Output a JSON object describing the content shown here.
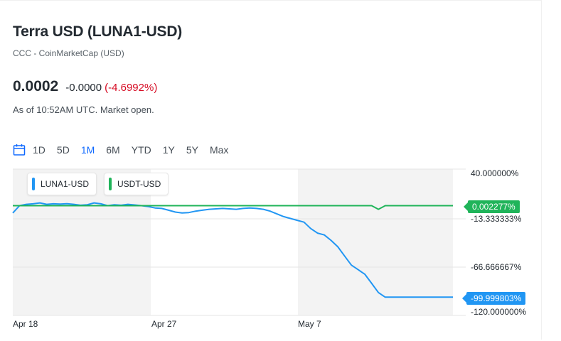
{
  "quote": {
    "title": "Terra USD (LUNA1-USD)",
    "subtitle": "CCC - CoinMarketCap (USD)",
    "price": "0.0002",
    "change": "-0.0000",
    "change_pct": "(-4.6992%)",
    "as_of": "As of 10:52AM UTC. Market open."
  },
  "ranges": [
    "1D",
    "5D",
    "1M",
    "6M",
    "YTD",
    "1Y",
    "5Y",
    "Max"
  ],
  "active_range": "1M",
  "colors": {
    "luna": "#2196f3",
    "usdt": "#20b45a",
    "negative": "#d60a22",
    "accent": "#0f69ff"
  },
  "chart_data": {
    "type": "line",
    "x_tick_labels": [
      "Apr 18",
      "Apr 27",
      "May 7"
    ],
    "y_tick_labels": [
      "40.000000%",
      "-13.333333%",
      "-66.666667%",
      "-120.000000%"
    ],
    "y_ticks": [
      40,
      -13.333333,
      -66.666667,
      -120
    ],
    "ylim": [
      -120,
      40
    ],
    "last_value_tags": {
      "usdt": "0.002277%",
      "luna": "-99.999803%"
    },
    "series": [
      {
        "name": "LUNA1-USD",
        "color": "#2196f3",
        "values": [
          -8,
          0,
          1.5,
          2,
          3,
          1.5,
          2,
          1.8,
          2.2,
          1.5,
          0.5,
          1,
          3,
          2,
          0,
          1,
          0.5,
          1.5,
          0.8,
          0,
          -1,
          -2.5,
          -3,
          -5,
          -7,
          -8,
          -7.5,
          -6,
          -5,
          -4,
          -3.5,
          -3,
          -3.5,
          -4,
          -3,
          -2.5,
          -3,
          -4,
          -6,
          -9,
          -12,
          -14,
          -16,
          -18,
          -25,
          -30,
          -32,
          -38,
          -45,
          -55,
          -65,
          -70,
          -75,
          -85,
          -95,
          -100,
          -100,
          -100,
          -100,
          -100,
          -100,
          -100,
          -100,
          -100,
          -100,
          -100
        ]
      },
      {
        "name": "USDT-USD",
        "color": "#20b45a",
        "values": [
          0,
          0,
          0,
          0,
          0,
          0,
          0,
          0,
          0,
          0,
          0,
          0,
          0,
          0,
          0,
          0,
          0,
          0,
          0,
          0,
          0,
          0,
          0,
          0,
          0,
          0,
          0,
          0,
          0,
          0,
          0,
          0,
          0,
          0,
          0,
          0,
          0,
          0,
          0,
          0,
          0,
          0,
          0,
          0,
          0,
          0,
          0,
          0,
          0,
          0,
          0,
          0,
          0,
          0,
          -4,
          0,
          0,
          0,
          0,
          0,
          0,
          0,
          0,
          0,
          0,
          0
        ]
      }
    ]
  }
}
